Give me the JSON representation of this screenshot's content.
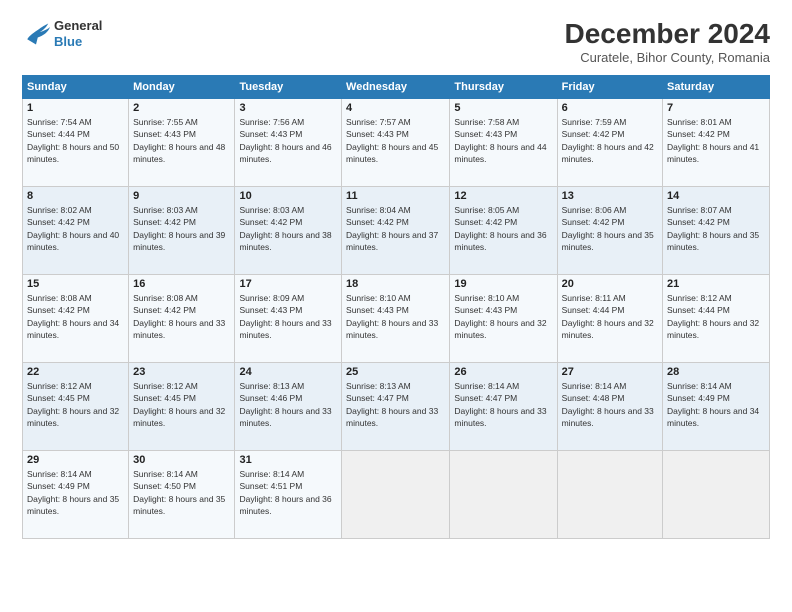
{
  "logo": {
    "line1": "General",
    "line2": "Blue"
  },
  "header": {
    "title": "December 2024",
    "subtitle": "Curatele, Bihor County, Romania"
  },
  "weekdays": [
    "Sunday",
    "Monday",
    "Tuesday",
    "Wednesday",
    "Thursday",
    "Friday",
    "Saturday"
  ],
  "weeks": [
    [
      {
        "day": "1",
        "sunrise": "7:54 AM",
        "sunset": "4:44 PM",
        "daylight": "8 hours and 50 minutes."
      },
      {
        "day": "2",
        "sunrise": "7:55 AM",
        "sunset": "4:43 PM",
        "daylight": "8 hours and 48 minutes."
      },
      {
        "day": "3",
        "sunrise": "7:56 AM",
        "sunset": "4:43 PM",
        "daylight": "8 hours and 46 minutes."
      },
      {
        "day": "4",
        "sunrise": "7:57 AM",
        "sunset": "4:43 PM",
        "daylight": "8 hours and 45 minutes."
      },
      {
        "day": "5",
        "sunrise": "7:58 AM",
        "sunset": "4:43 PM",
        "daylight": "8 hours and 44 minutes."
      },
      {
        "day": "6",
        "sunrise": "7:59 AM",
        "sunset": "4:42 PM",
        "daylight": "8 hours and 42 minutes."
      },
      {
        "day": "7",
        "sunrise": "8:01 AM",
        "sunset": "4:42 PM",
        "daylight": "8 hours and 41 minutes."
      }
    ],
    [
      {
        "day": "8",
        "sunrise": "8:02 AM",
        "sunset": "4:42 PM",
        "daylight": "8 hours and 40 minutes."
      },
      {
        "day": "9",
        "sunrise": "8:03 AM",
        "sunset": "4:42 PM",
        "daylight": "8 hours and 39 minutes."
      },
      {
        "day": "10",
        "sunrise": "8:03 AM",
        "sunset": "4:42 PM",
        "daylight": "8 hours and 38 minutes."
      },
      {
        "day": "11",
        "sunrise": "8:04 AM",
        "sunset": "4:42 PM",
        "daylight": "8 hours and 37 minutes."
      },
      {
        "day": "12",
        "sunrise": "8:05 AM",
        "sunset": "4:42 PM",
        "daylight": "8 hours and 36 minutes."
      },
      {
        "day": "13",
        "sunrise": "8:06 AM",
        "sunset": "4:42 PM",
        "daylight": "8 hours and 35 minutes."
      },
      {
        "day": "14",
        "sunrise": "8:07 AM",
        "sunset": "4:42 PM",
        "daylight": "8 hours and 35 minutes."
      }
    ],
    [
      {
        "day": "15",
        "sunrise": "8:08 AM",
        "sunset": "4:42 PM",
        "daylight": "8 hours and 34 minutes."
      },
      {
        "day": "16",
        "sunrise": "8:08 AM",
        "sunset": "4:42 PM",
        "daylight": "8 hours and 33 minutes."
      },
      {
        "day": "17",
        "sunrise": "8:09 AM",
        "sunset": "4:43 PM",
        "daylight": "8 hours and 33 minutes."
      },
      {
        "day": "18",
        "sunrise": "8:10 AM",
        "sunset": "4:43 PM",
        "daylight": "8 hours and 33 minutes."
      },
      {
        "day": "19",
        "sunrise": "8:10 AM",
        "sunset": "4:43 PM",
        "daylight": "8 hours and 32 minutes."
      },
      {
        "day": "20",
        "sunrise": "8:11 AM",
        "sunset": "4:44 PM",
        "daylight": "8 hours and 32 minutes."
      },
      {
        "day": "21",
        "sunrise": "8:12 AM",
        "sunset": "4:44 PM",
        "daylight": "8 hours and 32 minutes."
      }
    ],
    [
      {
        "day": "22",
        "sunrise": "8:12 AM",
        "sunset": "4:45 PM",
        "daylight": "8 hours and 32 minutes."
      },
      {
        "day": "23",
        "sunrise": "8:12 AM",
        "sunset": "4:45 PM",
        "daylight": "8 hours and 32 minutes."
      },
      {
        "day": "24",
        "sunrise": "8:13 AM",
        "sunset": "4:46 PM",
        "daylight": "8 hours and 33 minutes."
      },
      {
        "day": "25",
        "sunrise": "8:13 AM",
        "sunset": "4:47 PM",
        "daylight": "8 hours and 33 minutes."
      },
      {
        "day": "26",
        "sunrise": "8:14 AM",
        "sunset": "4:47 PM",
        "daylight": "8 hours and 33 minutes."
      },
      {
        "day": "27",
        "sunrise": "8:14 AM",
        "sunset": "4:48 PM",
        "daylight": "8 hours and 33 minutes."
      },
      {
        "day": "28",
        "sunrise": "8:14 AM",
        "sunset": "4:49 PM",
        "daylight": "8 hours and 34 minutes."
      }
    ],
    [
      {
        "day": "29",
        "sunrise": "8:14 AM",
        "sunset": "4:49 PM",
        "daylight": "8 hours and 35 minutes."
      },
      {
        "day": "30",
        "sunrise": "8:14 AM",
        "sunset": "4:50 PM",
        "daylight": "8 hours and 35 minutes."
      },
      {
        "day": "31",
        "sunrise": "8:14 AM",
        "sunset": "4:51 PM",
        "daylight": "8 hours and 36 minutes."
      },
      null,
      null,
      null,
      null
    ]
  ]
}
